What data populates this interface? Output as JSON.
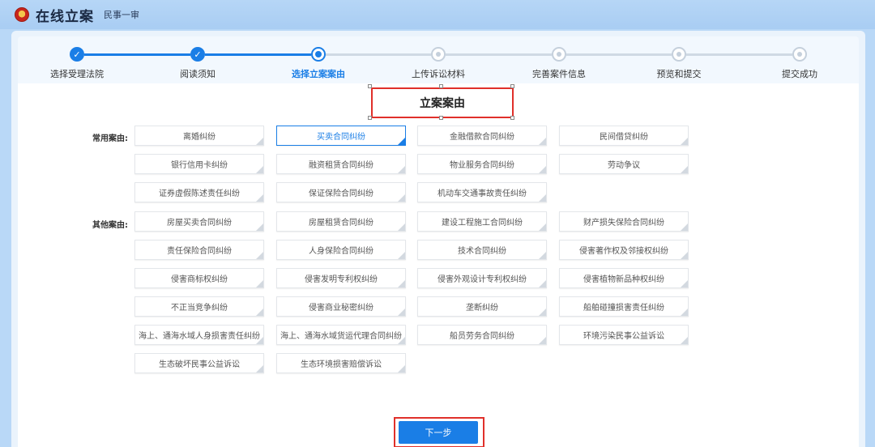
{
  "header": {
    "app_title": "在线立案",
    "subtitle": "民事一审"
  },
  "steps": [
    {
      "label": "选择受理法院",
      "status": "done"
    },
    {
      "label": "阅读须知",
      "status": "done"
    },
    {
      "label": "选择立案案由",
      "status": "current"
    },
    {
      "label": "上传诉讼材料",
      "status": "todo"
    },
    {
      "label": "完善案件信息",
      "status": "todo"
    },
    {
      "label": "预览和提交",
      "status": "todo"
    },
    {
      "label": "提交成功",
      "status": "todo"
    }
  ],
  "section_title": "立案案由",
  "common": {
    "label": "常用案由:",
    "items": [
      "离婚纠纷",
      "买卖合同纠纷",
      "金融借款合同纠纷",
      "民间借贷纠纷",
      "银行信用卡纠纷",
      "融资租赁合同纠纷",
      "物业服务合同纠纷",
      "劳动争议",
      "证券虚假陈述责任纠纷",
      "保证保险合同纠纷",
      "机动车交通事故责任纠纷"
    ],
    "selected": "买卖合同纠纷"
  },
  "other": {
    "label": "其他案由:",
    "items": [
      "房屋买卖合同纠纷",
      "房屋租赁合同纠纷",
      "建设工程施工合同纠纷",
      "财产损失保险合同纠纷",
      "责任保险合同纠纷",
      "人身保险合同纠纷",
      "技术合同纠纷",
      "侵害著作权及邻接权纠纷",
      "侵害商标权纠纷",
      "侵害发明专利权纠纷",
      "侵害外观设计专利权纠纷",
      "侵害植物新品种权纠纷",
      "不正当竞争纠纷",
      "侵害商业秘密纠纷",
      "垄断纠纷",
      "船舶碰撞损害责任纠纷",
      "海上、通海水域人身损害责任纠纷",
      "海上、通海水域货运代理合同纠纷",
      "船员劳务合同纠纷",
      "环境污染民事公益诉讼",
      "生态破坏民事公益诉讼",
      "生态环境损害赔偿诉讼"
    ]
  },
  "next_button": "下一步",
  "colors": {
    "accent": "#1a7ee6",
    "highlight_border": "#e0302a",
    "background": "#b9d8f7"
  }
}
